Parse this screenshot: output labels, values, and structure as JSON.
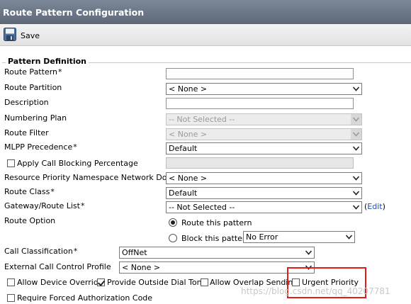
{
  "window": {
    "title": "Route Pattern Configuration"
  },
  "toolbar": {
    "save_label": "Save"
  },
  "section": {
    "legend": "Pattern Definition"
  },
  "fields": {
    "route_pattern": {
      "label": "Route Pattern",
      "required": "*",
      "value": ""
    },
    "route_partition": {
      "label": "Route Partition",
      "value": "< None >"
    },
    "description": {
      "label": "Description",
      "value": ""
    },
    "numbering_plan": {
      "label": "Numbering Plan",
      "value": "-- Not Selected --"
    },
    "route_filter": {
      "label": "Route Filter",
      "value": "< None >"
    },
    "mlpp_precedence": {
      "label": "MLPP Precedence",
      "required": "*",
      "value": "Default"
    },
    "apply_call_blocking": {
      "label": "Apply Call Blocking Percentage",
      "checked": false,
      "value": ""
    },
    "resource_priority": {
      "label": "Resource Priority Namespace Network Domain",
      "value": "< None >"
    },
    "route_class": {
      "label": "Route Class",
      "required": "*",
      "value": "Default"
    },
    "gateway_route_list": {
      "label": "Gateway/Route List",
      "required": "*",
      "value": "-- Not Selected --",
      "edit_open": "(",
      "edit_link": "Edit",
      "edit_close": ")"
    },
    "route_option": {
      "label": "Route Option",
      "route_this_pattern": "Route this pattern",
      "block_this_pattern": "Block this pattern",
      "block_reason": "No Error",
      "selected": "route"
    },
    "call_classification": {
      "label": "Call Classification",
      "required": "*",
      "value": "OffNet"
    },
    "external_call_control_profile": {
      "label": "External Call Control Profile",
      "value": "< None >"
    }
  },
  "checkboxes": [
    {
      "label": "Allow Device Override",
      "checked": false
    },
    {
      "label": "Provide Outside Dial Tone",
      "checked": true
    },
    {
      "label": "Allow Overlap Sending",
      "checked": false
    },
    {
      "label": "Urgent Priority",
      "checked": false
    },
    {
      "label": "Require Forced Authorization Code",
      "checked": false
    }
  ],
  "watermark": "https://blog.csdn.net/qq_40207781",
  "colors": {
    "title_bar": "#6b7585",
    "highlight": "#e21b1b",
    "link": "#1f4fa6"
  }
}
